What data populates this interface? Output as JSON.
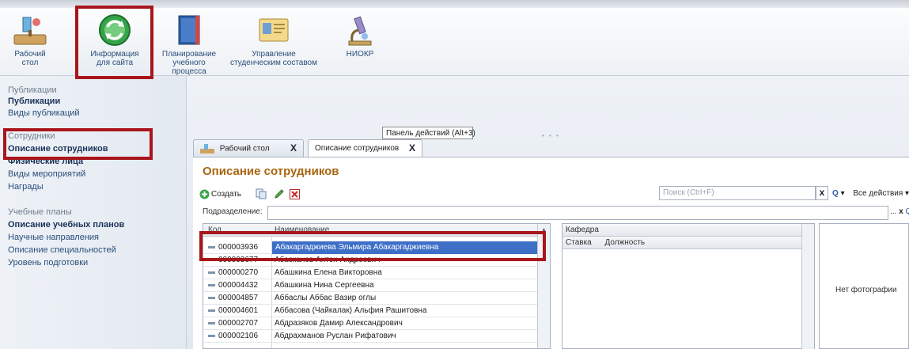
{
  "toolbar": {
    "items": [
      {
        "l1": "Рабочий",
        "l2": "стол",
        "icon": "desk-icon"
      },
      {
        "l1": "Информация",
        "l2": "для сайта",
        "icon": "refresh-globe-icon"
      },
      {
        "l1": "Планирование",
        "l2": "учебного процесса",
        "icon": "book-icon"
      },
      {
        "l1": "Управление",
        "l2": "студенческим составом",
        "icon": "id-card-icon"
      },
      {
        "l1": "НИОКР",
        "l2": "",
        "icon": "microscope-icon"
      }
    ]
  },
  "sidebar": {
    "publications_title": "Публикации",
    "publications_items": [
      "Публикации",
      "Виды публикаций"
    ],
    "staff_title": "Сотрудники",
    "staff_items": [
      "Описание сотрудников",
      "Физические лица",
      "Виды мероприятий",
      "Награды"
    ],
    "plans_title": "Учебные планы",
    "plans_items": [
      "Описание учебных планов",
      "Научные направления",
      "Описание специальностей",
      "Уровень подготовки"
    ]
  },
  "tooltip": "Панель действий (Alt+3)",
  "tabs": [
    {
      "label": "Рабочий стол",
      "close": "X"
    },
    {
      "label": "Описание сотрудников",
      "close": "X"
    }
  ],
  "page_title": "Описание сотрудников",
  "commands": {
    "create": "Создать",
    "search_placeholder": "Поиск (Ctrl+F)",
    "search_clear": "x",
    "all_actions": "Все действия",
    "help": "?"
  },
  "department": {
    "label": "Подразделение:",
    "btns": "...",
    "clear": "x",
    "open": "Q"
  },
  "table": {
    "col_code": "Код",
    "col_name": "Наименование",
    "rows": [
      {
        "code": "000003936",
        "name": "Абакаргаджиева Эльмира Абакаргаджиевна"
      },
      {
        "code": "000003677",
        "name": "Абасканов Антон Андреевич"
      },
      {
        "code": "000000270",
        "name": "Абашкина Елена Викторовна"
      },
      {
        "code": "000004432",
        "name": "Абашкина Нина Сергеевна"
      },
      {
        "code": "000004857",
        "name": "Аббаслы Аббас Вазир оглы"
      },
      {
        "code": "000004601",
        "name": "Аббасова (Чайкалак) Альфия Рашитовна"
      },
      {
        "code": "000002707",
        "name": "Абдразяков Дамир Александрович"
      },
      {
        "code": "000002106",
        "name": "Абдрахманов Руслан Рифатович"
      }
    ]
  },
  "dept_table": {
    "h1": "Кафедра",
    "h2a": "Ставка",
    "h2b": "Должность"
  },
  "photo": {
    "text": "Нет фотографии"
  }
}
